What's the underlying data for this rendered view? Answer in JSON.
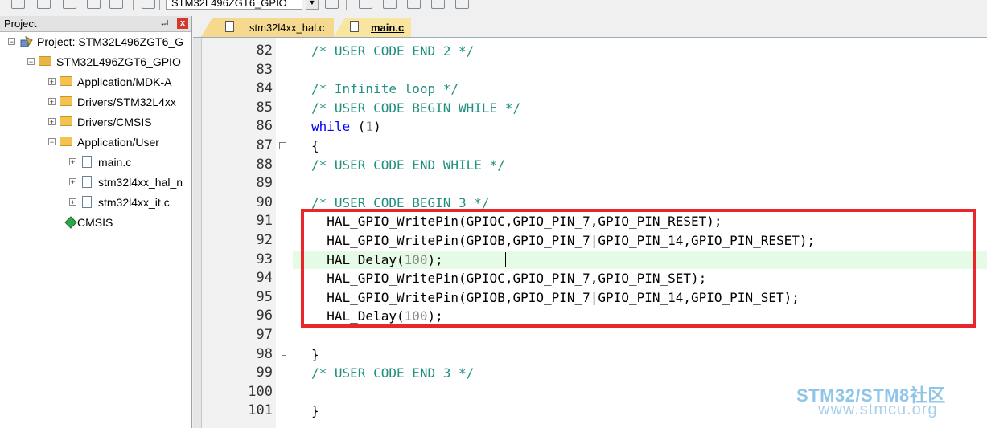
{
  "toolbar": {
    "target_name": "STM32L496ZGT6_GPIO"
  },
  "project_panel": {
    "title": "Project",
    "pin_glyph": "ᆔ",
    "close_glyph": "x",
    "tree": [
      {
        "label": "Project: STM32L496ZGT6_G",
        "icon": "project-icon",
        "expander": "−"
      },
      {
        "label": "STM32L496ZGT6_GPIO",
        "icon": "target-folder-icon",
        "expander": "−"
      },
      {
        "label": "Application/MDK-A",
        "icon": "folder-icon",
        "expander": "+"
      },
      {
        "label": "Drivers/STM32L4xx_",
        "icon": "folder-icon",
        "expander": "+"
      },
      {
        "label": "Drivers/CMSIS",
        "icon": "folder-icon",
        "expander": "+"
      },
      {
        "label": "Application/User",
        "icon": "folder-open-icon",
        "expander": "−"
      },
      {
        "label": "main.c",
        "icon": "file-icon",
        "expander": "+"
      },
      {
        "label": "stm32l4xx_hal_n",
        "icon": "file-icon",
        "expander": "+"
      },
      {
        "label": "stm32l4xx_it.c",
        "icon": "file-icon",
        "expander": "+"
      },
      {
        "label": "CMSIS",
        "icon": "cmsis-diamond-icon",
        "expander": ""
      }
    ]
  },
  "editor": {
    "tabs": [
      {
        "label": "stm32l4xx_hal.c",
        "active": false
      },
      {
        "label": "main.c",
        "active": true
      }
    ],
    "lines": [
      {
        "num": "82",
        "parts": [
          {
            "t": "/* USER CODE END 2 */",
            "c": "comment"
          }
        ]
      },
      {
        "num": "83",
        "parts": []
      },
      {
        "num": "84",
        "parts": [
          {
            "t": "/* Infinite loop */",
            "c": "comment"
          }
        ]
      },
      {
        "num": "85",
        "parts": [
          {
            "t": "/* USER CODE BEGIN WHILE */",
            "c": "comment"
          }
        ]
      },
      {
        "num": "86",
        "parts": [
          {
            "t": "while",
            "c": "keyword"
          },
          {
            "t": " (",
            "c": "plain"
          },
          {
            "t": "1",
            "c": "num"
          },
          {
            "t": ")",
            "c": "plain"
          }
        ]
      },
      {
        "num": "87",
        "parts": [
          {
            "t": "{",
            "c": "plain"
          }
        ]
      },
      {
        "num": "88",
        "parts": [
          {
            "t": "/* USER CODE END WHILE */",
            "c": "comment"
          }
        ]
      },
      {
        "num": "89",
        "parts": []
      },
      {
        "num": "90",
        "parts": [
          {
            "t": "/* USER CODE BEGIN 3 */",
            "c": "comment"
          }
        ]
      },
      {
        "num": "91",
        "parts": [
          {
            "t": "  HAL_GPIO_WritePin(GPIOC,GPIO_PIN_7,GPIO_PIN_RESET);",
            "c": "plain"
          }
        ]
      },
      {
        "num": "92",
        "parts": [
          {
            "t": "  HAL_GPIO_WritePin(GPIOB,GPIO_PIN_7|GPIO_PIN_14,GPIO_PIN_RESET);",
            "c": "plain"
          }
        ]
      },
      {
        "num": "93",
        "parts": [
          {
            "t": "  HAL_Delay(",
            "c": "plain"
          },
          {
            "t": "100",
            "c": "num"
          },
          {
            "t": ");",
            "c": "plain"
          }
        ]
      },
      {
        "num": "94",
        "parts": [
          {
            "t": "  HAL_GPIO_WritePin(GPIOC,GPIO_PIN_7,GPIO_PIN_SET);",
            "c": "plain"
          }
        ]
      },
      {
        "num": "95",
        "parts": [
          {
            "t": "  HAL_GPIO_WritePin(GPIOB,GPIO_PIN_7|GPIO_PIN_14,GPIO_PIN_SET);",
            "c": "plain"
          }
        ]
      },
      {
        "num": "96",
        "parts": [
          {
            "t": "  HAL_Delay(",
            "c": "plain"
          },
          {
            "t": "100",
            "c": "num"
          },
          {
            "t": ");",
            "c": "plain"
          }
        ]
      },
      {
        "num": "97",
        "parts": []
      },
      {
        "num": "98",
        "parts": [
          {
            "t": "}",
            "c": "plain"
          }
        ]
      },
      {
        "num": "99",
        "parts": [
          {
            "t": "/* USER CODE END 3 */",
            "c": "comment"
          }
        ]
      },
      {
        "num": "100",
        "parts": []
      },
      {
        "num": "101",
        "parts": [
          {
            "t": "}",
            "c": "plain"
          }
        ]
      }
    ],
    "current_line": "93"
  },
  "watermark": {
    "line1": "STM32/STM8社区",
    "line2": "www.stmcu.org"
  },
  "colors": {
    "comment": "#1f8f7f",
    "keyword": "#0000ff",
    "highlight_box": "#e8262b",
    "current_line_bg": "#e6fbe6"
  }
}
